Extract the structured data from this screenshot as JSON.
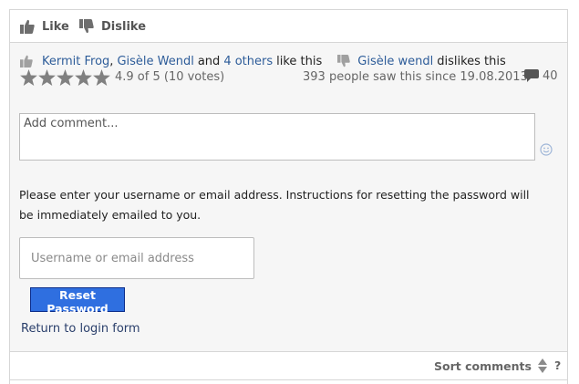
{
  "toolbar": {
    "like_label": "Like",
    "dislike_label": "Dislike"
  },
  "likes": {
    "user1": "Kermit Frog",
    "separator": ",",
    "user2": "Gisèle Wendl",
    "and_text": "and",
    "others_link": "4 others",
    "suffix": "like this"
  },
  "dislikes": {
    "user": "Gisèle wendl",
    "suffix": "dislikes this"
  },
  "rating": {
    "stars_total": 5,
    "text": "4.9 of 5 (10 votes)"
  },
  "seen_text": "393 people saw this since 19.08.2013",
  "comment_count": "40",
  "comment": {
    "placeholder": "Add comment...",
    "value": ""
  },
  "reset": {
    "instructions": "Please enter your username or email address. Instructions for resetting the password will be immediately emailed to you.",
    "username_placeholder": "Username or email address",
    "button_label": "Reset Password",
    "return_link": "Return to login form"
  },
  "footer": {
    "sort_label": "Sort comments",
    "help_label": "?"
  },
  "colors": {
    "accent": "#2f6fe0",
    "link": "#2d5c99",
    "icon_gray": "#808080",
    "background": "#f6f6f6"
  },
  "icons": {
    "like": "thumbs-up-icon",
    "dislike": "thumbs-down-icon",
    "star": "star-icon",
    "comment": "speech-bubble-icon",
    "smiley": "smiley-icon",
    "sort": "sort-arrows-icon"
  }
}
